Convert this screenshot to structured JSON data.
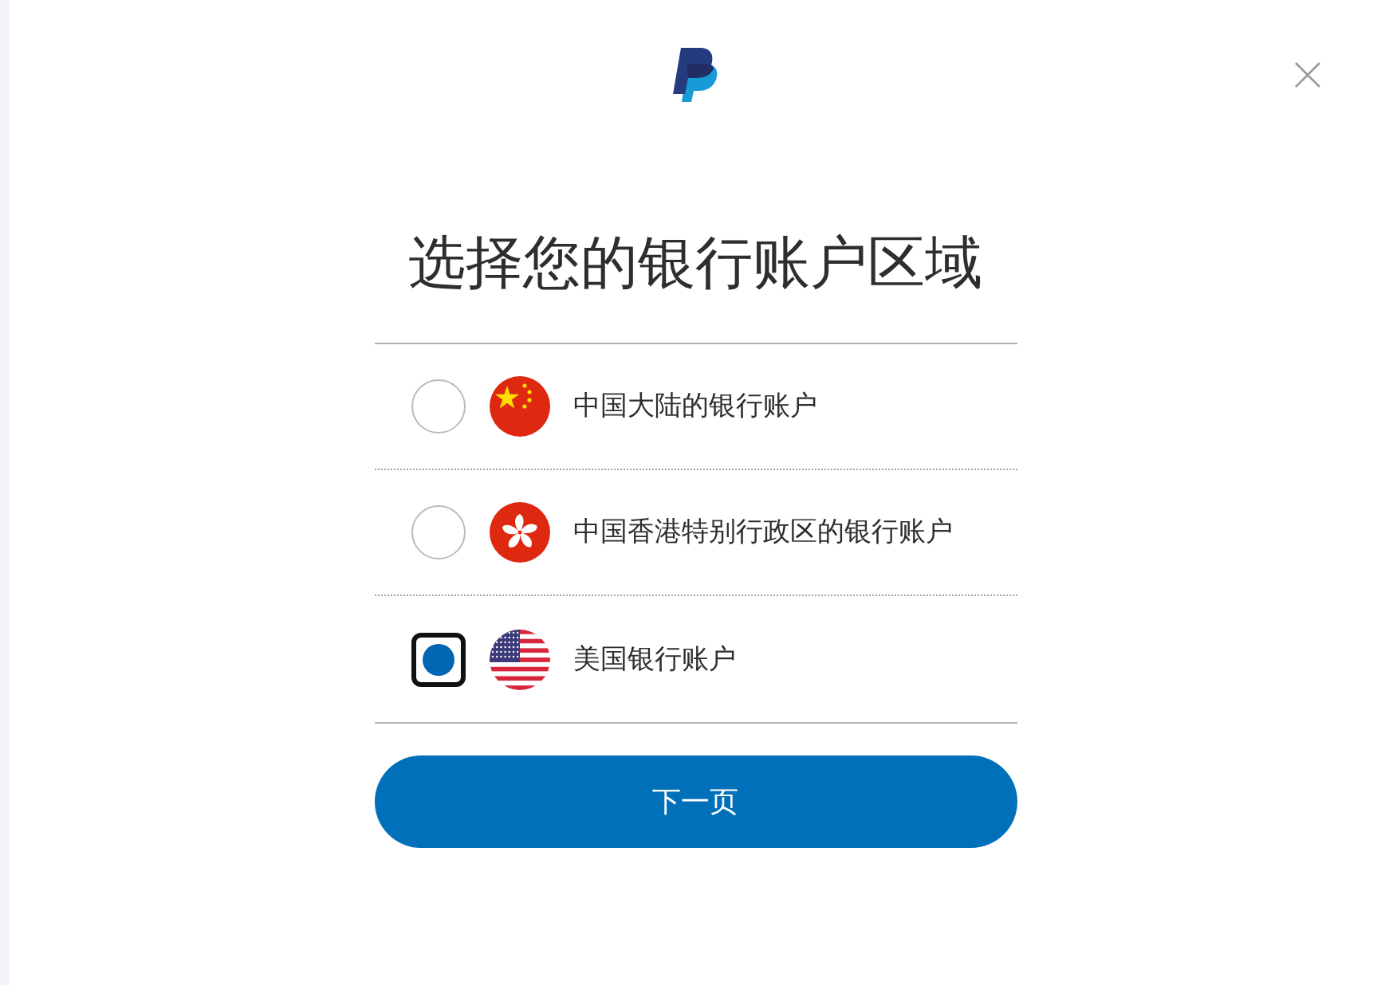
{
  "dialog": {
    "title": "选择您的银行账户区域",
    "options": [
      {
        "label": "中国大陆的银行账户",
        "selected": false
      },
      {
        "label": "中国香港特别行政区的银行账户",
        "selected": false
      },
      {
        "label": "美国银行账户",
        "selected": true
      }
    ],
    "button": {
      "label": "下一页"
    }
  }
}
